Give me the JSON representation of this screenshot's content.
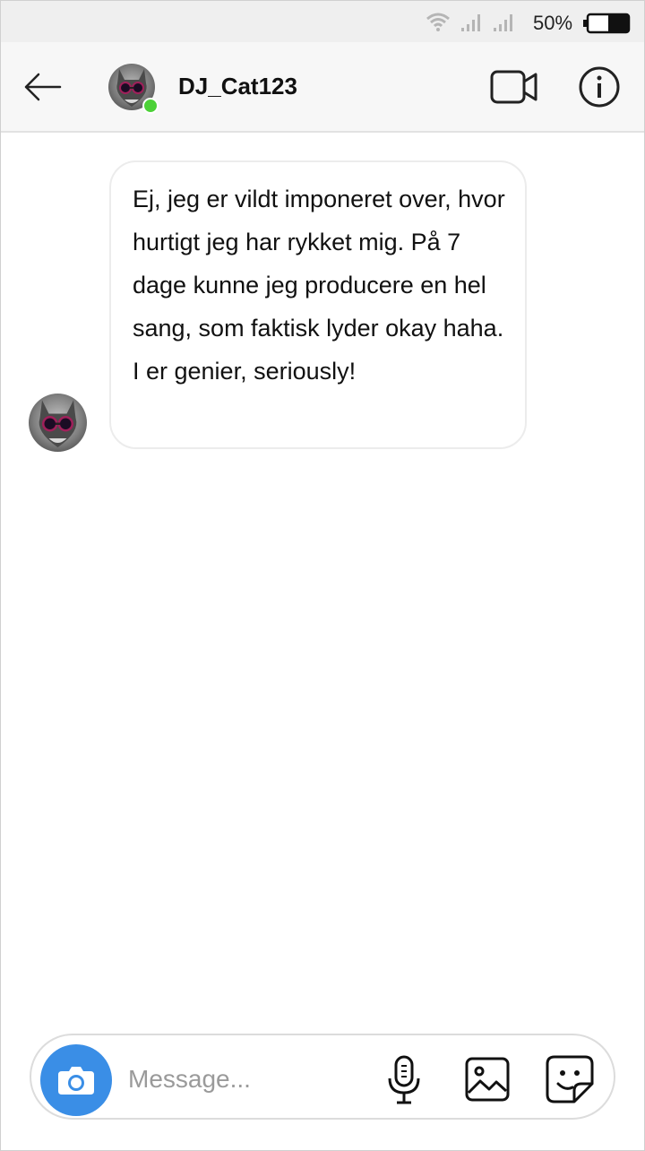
{
  "status_bar": {
    "battery_percent": "50%",
    "battery_level": 0.5,
    "icons": [
      "wifi-icon",
      "signal-icon",
      "signal-icon",
      "battery-icon"
    ]
  },
  "header": {
    "contact_name": "DJ_Cat123",
    "online": true,
    "icons": [
      "back-arrow-icon",
      "video-call-icon",
      "info-icon"
    ]
  },
  "conversation": {
    "messages": [
      {
        "from": "DJ_Cat123",
        "text": "Ej, jeg er vildt imponeret over, hvor hurtigt jeg har rykket mig. På 7 dage kunne jeg producere en hel sang, som faktisk lyder okay haha. I er genier, seriously!"
      }
    ]
  },
  "composer": {
    "placeholder": "Message...",
    "value": "",
    "icons": [
      "camera-icon",
      "microphone-icon",
      "image-icon",
      "sticker-icon"
    ]
  },
  "colors": {
    "online": "#4cd137",
    "camera_button": "#3a8ee6",
    "header_bg": "#f7f7f7",
    "status_bg": "#efefef"
  }
}
